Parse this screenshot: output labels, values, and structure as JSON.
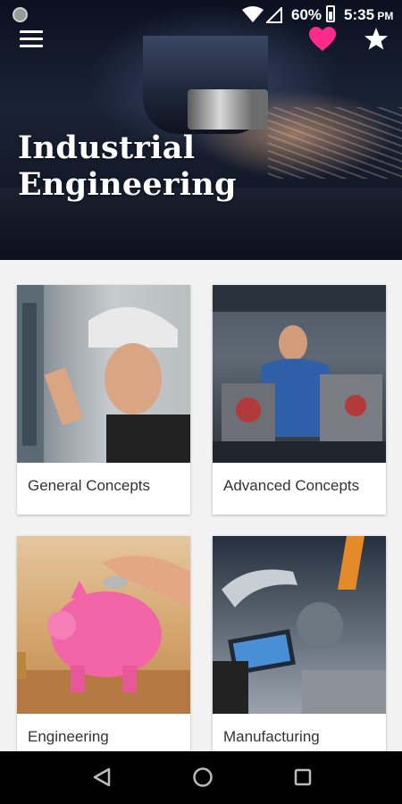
{
  "status_bar": {
    "battery_percent": "60%",
    "time": "5:35",
    "time_suffix": "PM"
  },
  "header": {
    "title": "Industrial Engineering",
    "menu_icon": "menu-icon",
    "favorite_icon": "heart-icon",
    "rate_icon": "star-icon",
    "favorite_color": "#ff2a8a"
  },
  "categories": [
    {
      "label": "General Concepts",
      "image": "worker-hard-hat-electrical-panel"
    },
    {
      "label": "Advanced Concepts",
      "image": "machinist-working-on-engine"
    },
    {
      "label": "Engineering",
      "image": "pink-piggy-bank-coin"
    },
    {
      "label": "Manufacturing",
      "image": "robotic-arm-tablet-factory"
    }
  ],
  "nav_bar": {
    "back_icon": "back-triangle-icon",
    "home_icon": "home-circle-icon",
    "recents_icon": "recents-square-icon"
  }
}
